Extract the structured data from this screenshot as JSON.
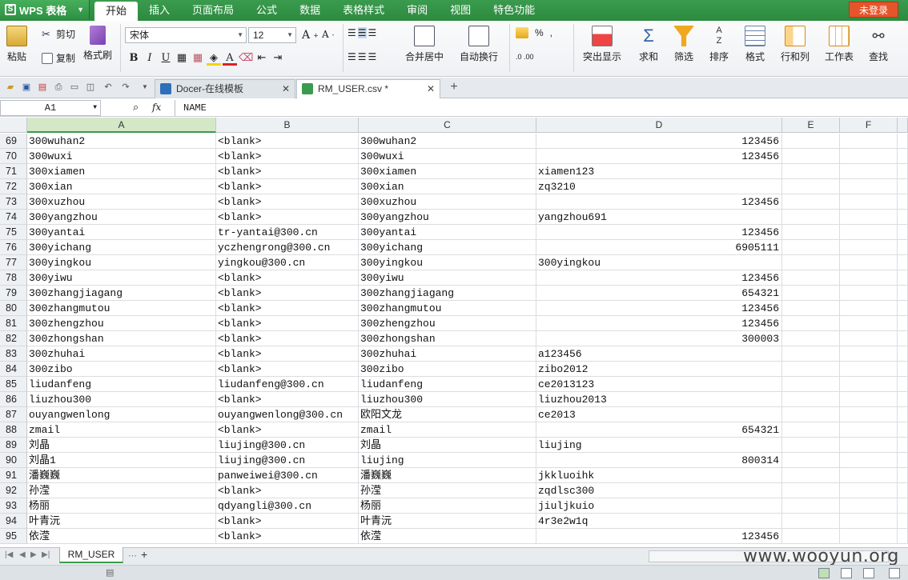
{
  "app": {
    "name": "WPS 表格",
    "login_label": "未登录"
  },
  "menu": [
    "开始",
    "插入",
    "页面布局",
    "公式",
    "数据",
    "表格样式",
    "审阅",
    "视图",
    "特色功能"
  ],
  "ribbon": {
    "paste": "粘贴",
    "cut": "剪切",
    "copy": "复制",
    "format_painter": "格式刷",
    "font_name": "宋体",
    "font_size": "12",
    "bold": "B",
    "italic": "I",
    "underline": "U",
    "merge_center": "合并居中",
    "wrap_text": "自动换行",
    "percent": "%",
    "comma": ",",
    "highlight": "突出显示",
    "sum": "求和",
    "filter": "筛选",
    "sort": "排序",
    "format": "格式",
    "row_col": "行和列",
    "worksheet": "工作表",
    "find": "查找"
  },
  "tabs": [
    {
      "label": "Docer-在线模板",
      "active": false
    },
    {
      "label": "RM_USER.csv *",
      "active": true
    }
  ],
  "formula_bar": {
    "cell_ref": "A1",
    "fx": "fx",
    "value": "NAME"
  },
  "columns": [
    "A",
    "B",
    "C",
    "D",
    "E",
    "F"
  ],
  "rows": [
    {
      "n": "69",
      "a": "300wuhan2",
      "b": "<blank>",
      "c": "300wuhan2",
      "d": "123456",
      "dnum": true
    },
    {
      "n": "70",
      "a": "300wuxi",
      "b": "<blank>",
      "c": "300wuxi",
      "d": "123456",
      "dnum": true
    },
    {
      "n": "71",
      "a": "300xiamen",
      "b": "<blank>",
      "c": "300xiamen",
      "d": "xiamen123",
      "dnum": false
    },
    {
      "n": "72",
      "a": "300xian",
      "b": "<blank>",
      "c": "300xian",
      "d": "zq3210",
      "dnum": false
    },
    {
      "n": "73",
      "a": "300xuzhou",
      "b": "<blank>",
      "c": "300xuzhou",
      "d": "123456",
      "dnum": true
    },
    {
      "n": "74",
      "a": "300yangzhou",
      "b": "<blank>",
      "c": "300yangzhou",
      "d": "yangzhou691",
      "dnum": false
    },
    {
      "n": "75",
      "a": "300yantai",
      "b": "tr-yantai@300.cn",
      "c": "300yantai",
      "d": "123456",
      "dnum": true
    },
    {
      "n": "76",
      "a": "300yichang",
      "b": "yczhengrong@300.cn",
      "c": "300yichang",
      "d": "6905111",
      "dnum": true
    },
    {
      "n": "77",
      "a": "300yingkou",
      "b": "yingkou@300.cn",
      "c": "300yingkou",
      "d": "300yingkou",
      "dnum": false
    },
    {
      "n": "78",
      "a": "300yiwu",
      "b": "<blank>",
      "c": "300yiwu",
      "d": "123456",
      "dnum": true
    },
    {
      "n": "79",
      "a": "300zhangjiagang",
      "b": "<blank>",
      "c": "300zhangjiagang",
      "d": "654321",
      "dnum": true
    },
    {
      "n": "80",
      "a": "300zhangmutou",
      "b": "<blank>",
      "c": "300zhangmutou",
      "d": "123456",
      "dnum": true
    },
    {
      "n": "81",
      "a": "300zhengzhou",
      "b": "<blank>",
      "c": "300zhengzhou",
      "d": "123456",
      "dnum": true
    },
    {
      "n": "82",
      "a": "300zhongshan",
      "b": "<blank>",
      "c": "300zhongshan",
      "d": "300003",
      "dnum": true
    },
    {
      "n": "83",
      "a": "300zhuhai",
      "b": "<blank>",
      "c": "300zhuhai",
      "d": "a123456",
      "dnum": false
    },
    {
      "n": "84",
      "a": "300zibo",
      "b": "<blank>",
      "c": "300zibo",
      "d": "zibo2012",
      "dnum": false
    },
    {
      "n": "85",
      "a": "liudanfeng",
      "b": "liudanfeng@300.cn",
      "c": "liudanfeng",
      "d": "ce2013123",
      "dnum": false
    },
    {
      "n": "86",
      "a": "liuzhou300",
      "b": "<blank>",
      "c": "liuzhou300",
      "d": "liuzhou2013",
      "dnum": false
    },
    {
      "n": "87",
      "a": "ouyangwenlong",
      "b": "ouyangwenlong@300.cn",
      "c": "欧阳文龙",
      "d": "ce2013",
      "dnum": false
    },
    {
      "n": "88",
      "a": "zmail",
      "b": "<blank>",
      "c": "zmail",
      "d": "654321",
      "dnum": true
    },
    {
      "n": "89",
      "a": "刘晶",
      "b": "liujing@300.cn",
      "c": "刘晶",
      "d": "liujing",
      "dnum": false
    },
    {
      "n": "90",
      "a": "刘晶1",
      "b": "liujing@300.cn",
      "c": "liujing",
      "d": "800314",
      "dnum": true
    },
    {
      "n": "91",
      "a": "潘巍巍",
      "b": "panweiwei@300.cn",
      "c": "潘巍巍",
      "d": "jkkluoihk",
      "dnum": false
    },
    {
      "n": "92",
      "a": "孙滢",
      "b": "<blank>",
      "c": "孙滢",
      "d": "zqdlsc300",
      "dnum": false
    },
    {
      "n": "93",
      "a": "杨丽",
      "b": "qdyangli@300.cn",
      "c": "杨丽",
      "d": "jiuljkuio",
      "dnum": false
    },
    {
      "n": "94",
      "a": "叶青沅",
      "b": "<blank>",
      "c": "叶青沅",
      "d": "4r3e2w1q",
      "dnum": false
    },
    {
      "n": "95",
      "a": "依滢",
      "b": "<blank>",
      "c": "依滢",
      "d": "123456",
      "dnum": true
    }
  ],
  "sheet": {
    "name": "RM_USER",
    "add": "+"
  },
  "watermark": "www.wooyun.org",
  "colors": {
    "accent": "#3a9b4e",
    "login": "#e4552b"
  }
}
